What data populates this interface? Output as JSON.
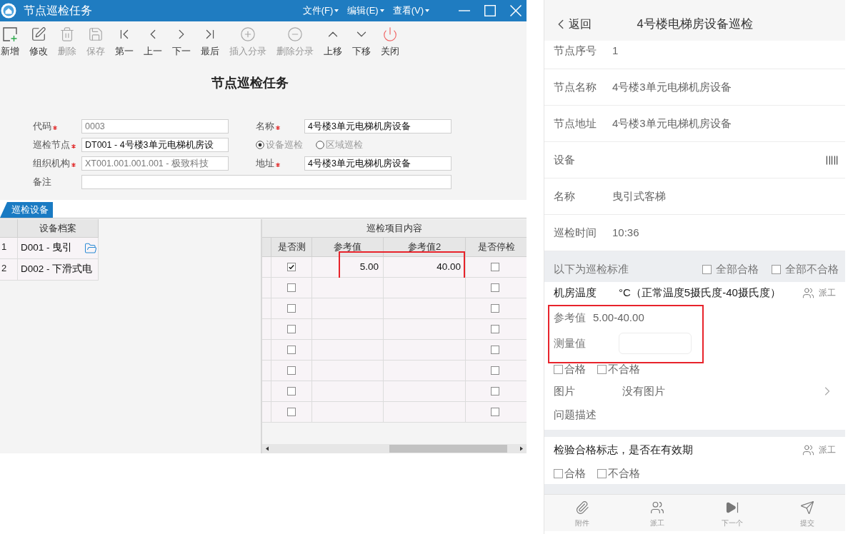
{
  "window": {
    "title": "节点巡检任务",
    "menus": [
      "文件(F)",
      "编辑(E)",
      "查看(V)"
    ]
  },
  "toolbar": [
    {
      "label": "新增",
      "kind": "add",
      "disabled": false
    },
    {
      "label": "修改",
      "kind": "edit",
      "disabled": false
    },
    {
      "label": "删除",
      "kind": "delete",
      "disabled": true
    },
    {
      "label": "保存",
      "kind": "save",
      "disabled": true
    },
    {
      "label": "第一",
      "kind": "first",
      "disabled": false
    },
    {
      "label": "上一",
      "kind": "prev",
      "disabled": false
    },
    {
      "label": "下一",
      "kind": "next",
      "disabled": false
    },
    {
      "label": "最后",
      "kind": "last",
      "disabled": false
    },
    {
      "label": "插入分录",
      "kind": "insert",
      "disabled": true
    },
    {
      "label": "删除分录",
      "kind": "remove",
      "disabled": true
    },
    {
      "label": "上移",
      "kind": "up",
      "disabled": false
    },
    {
      "label": "下移",
      "kind": "down",
      "disabled": false
    },
    {
      "label": "关闭",
      "kind": "close",
      "disabled": false
    }
  ],
  "form": {
    "heading": "节点巡检任务",
    "rows": [
      [
        {
          "kind": "input",
          "label": "代码",
          "required": true,
          "value": "0003",
          "readonly": true
        },
        {
          "kind": "input",
          "label": "名称",
          "required": true,
          "value": "4号楼3单元电梯机房设备",
          "readonly": false
        }
      ],
      [
        {
          "kind": "input",
          "label": "巡检节点",
          "required": true,
          "value": "DT001 - 4号楼3单元电梯机房设",
          "readonly": false
        },
        {
          "kind": "radio",
          "disabled": true,
          "options": [
            {
              "label": "设备巡检",
              "selected": true
            },
            {
              "label": "区域巡检",
              "selected": false
            }
          ]
        }
      ],
      [
        {
          "kind": "input",
          "label": "组织机构",
          "required": true,
          "value": "XT001.001.001.001 - 极致科技",
          "readonly": true
        },
        {
          "kind": "input",
          "label": "地址",
          "required": true,
          "value": "4号楼3单元电梯机房设备",
          "readonly": false
        }
      ],
      [
        {
          "kind": "wide",
          "label": "备注"
        }
      ]
    ]
  },
  "tabs": [
    {
      "label": "巡检设备",
      "selected": true
    }
  ],
  "equipment_grid": {
    "columns": [
      "设备档案"
    ],
    "rows": [
      {
        "number": "1",
        "name": "D001 - 曳引",
        "browse": true
      },
      {
        "number": "2",
        "name": "D002 - 下滑式电"
      }
    ]
  },
  "items_grid": {
    "title": "巡检项目内容",
    "columns": [
      "是否测",
      "参考值",
      "参考值2",
      "是否停检"
    ],
    "rows": [
      {
        "measured": true,
        "reference_1": "5.00",
        "reference_2": "40.00",
        "paused": false,
        "highlighted": true
      },
      {
        "measured": false,
        "paused": false
      },
      {
        "measured": false,
        "paused": false
      },
      {
        "measured": false,
        "paused": false
      },
      {
        "measured": false,
        "paused": false
      },
      {
        "measured": false,
        "paused": false
      },
      {
        "measured": false,
        "paused": false
      },
      {
        "measured": false,
        "paused": false
      }
    ]
  },
  "mobile": {
    "back": "返回",
    "title": "4号楼电梯房设备巡检",
    "info_rows": [
      {
        "kind": "text",
        "label": "节点序号",
        "value": "1"
      },
      {
        "kind": "text",
        "label": "节点名称",
        "value": "4号楼3单元电梯机房设备"
      },
      {
        "kind": "text",
        "label": "节点地址",
        "value": "4号楼3单元电梯机房设备"
      },
      {
        "kind": "scan",
        "label": "设备"
      },
      {
        "kind": "text",
        "label": "名称",
        "value": "曳引式客梯"
      },
      {
        "kind": "text",
        "label": "巡检时间",
        "value": "10:36"
      }
    ],
    "standards": {
      "title": "以下为巡检标准",
      "options": [
        {
          "label": "全部合格",
          "checked": false
        },
        {
          "label": "全部不合格",
          "checked": false
        }
      ]
    },
    "items": [
      {
        "name": "机房温度",
        "unit": "°C（正常温度5摄氏度-40摄氏度）",
        "assign": "派工",
        "highlighted": true,
        "reference_label": "参考值",
        "reference": "5.00-40.00",
        "measure_label": "测量值",
        "checks": [
          {
            "label": "合格",
            "checked": false
          },
          {
            "label": "不合格",
            "checked": false
          }
        ],
        "photo_label": "图片",
        "photo_value": "没有图片",
        "description_label": "问题描述"
      },
      {
        "name": "检验合格标志，是否在有效期",
        "assign": "派工",
        "checks": [
          {
            "label": "合格",
            "checked": false
          },
          {
            "label": "不合格",
            "checked": false
          }
        ]
      }
    ],
    "bottom_bar": [
      {
        "kind": "attach",
        "label": "附件"
      },
      {
        "kind": "assign",
        "label": "派工"
      },
      {
        "kind": "next",
        "label": "下一个"
      },
      {
        "kind": "submit",
        "label": "提交"
      }
    ]
  }
}
